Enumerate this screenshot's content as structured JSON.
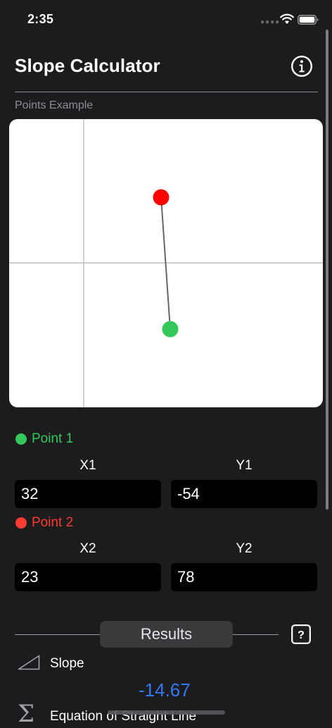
{
  "status_bar": {
    "time": "2:35"
  },
  "header": {
    "title": "Slope Calculator"
  },
  "points_example": {
    "label": "Points Example"
  },
  "graph": {
    "point1": {
      "color": "#34c759"
    },
    "point2": {
      "color": "#ff0000"
    }
  },
  "point1": {
    "label": "Point 1",
    "x_label": "X1",
    "y_label": "Y1",
    "x_value": "32",
    "y_value": "-54",
    "color": "#34c759"
  },
  "point2": {
    "label": "Point 2",
    "x_label": "X2",
    "y_label": "Y2",
    "x_value": "23",
    "y_value": "78",
    "color": "#ff3b30"
  },
  "results": {
    "title": "Results",
    "slope_label": "Slope",
    "slope_value": "-14.67",
    "equation_label": "Equation of Straight Line"
  },
  "icons": {
    "info": "info-circle-icon",
    "help": "question-square-icon",
    "slope": "triangle-slope-icon",
    "sum": "sigma-icon",
    "wifi": "wifi-icon",
    "battery": "battery-icon"
  }
}
